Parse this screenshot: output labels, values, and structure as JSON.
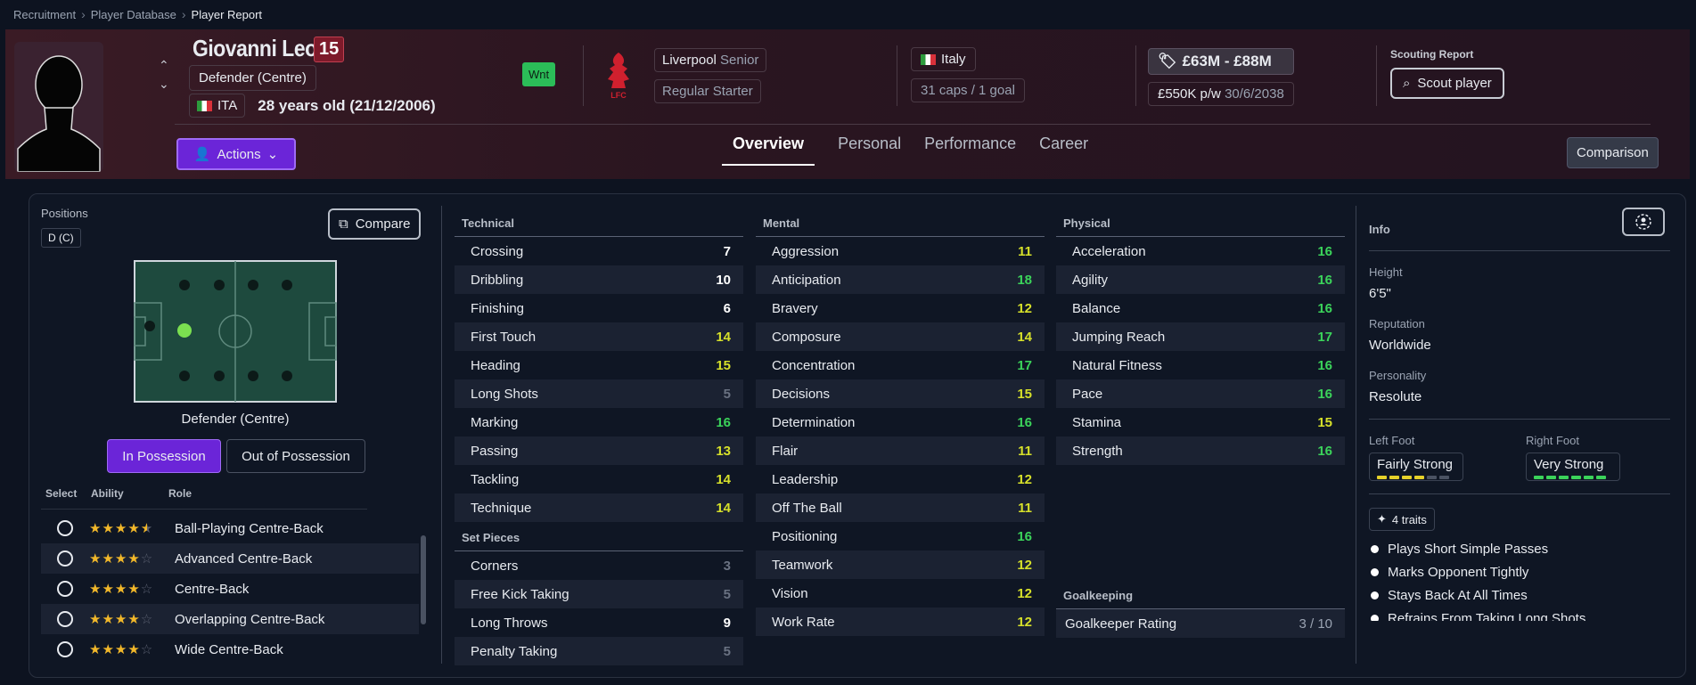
{
  "breadcrumb": {
    "items": [
      "Recruitment",
      "Player Database"
    ],
    "current": "Player Report"
  },
  "player": {
    "name": "Giovanni Leoni",
    "number": "15",
    "position": "Defender (Centre)",
    "nation_code": "ITA",
    "age": "28 years old (21/12/2006)",
    "badge": "Wnt",
    "club": "Liverpool",
    "squad": "Senior",
    "squad_status": "Regular Starter",
    "nation": "Italy",
    "caps": "31 caps / 1 goal",
    "value": "£63M - £88M",
    "wage": "£550K p/w",
    "contract": "30/6/2038"
  },
  "scouting": {
    "label": "Scouting Report",
    "button": "Scout player"
  },
  "nav": {
    "actions": "Actions",
    "tabs": [
      "Overview",
      "Personal",
      "Performance",
      "Career"
    ],
    "comparison": "Comparison"
  },
  "positions": {
    "label": "Positions",
    "tag": "D (C)",
    "compare": "Compare",
    "pitch_label": "Defender (Centre)",
    "in_possession": "In Possession",
    "out_of_possession": "Out of Possession",
    "headers": [
      "Select",
      "Ability",
      "Role"
    ],
    "roles": [
      {
        "name": "Ball-Playing Centre-Back",
        "stars": 4.5
      },
      {
        "name": "Advanced Centre-Back",
        "stars": 4
      },
      {
        "name": "Centre-Back",
        "stars": 4
      },
      {
        "name": "Overlapping Centre-Back",
        "stars": 4
      },
      {
        "name": "Wide Centre-Back",
        "stars": 4
      }
    ]
  },
  "technical": {
    "title": "Technical",
    "items": [
      [
        "Crossing",
        "7"
      ],
      [
        "Dribbling",
        "10"
      ],
      [
        "Finishing",
        "6"
      ],
      [
        "First Touch",
        "14"
      ],
      [
        "Heading",
        "15"
      ],
      [
        "Long Shots",
        "5"
      ],
      [
        "Marking",
        "16"
      ],
      [
        "Passing",
        "13"
      ],
      [
        "Tackling",
        "14"
      ],
      [
        "Technique",
        "14"
      ]
    ]
  },
  "set_pieces": {
    "title": "Set Pieces",
    "items": [
      [
        "Corners",
        "3"
      ],
      [
        "Free Kick Taking",
        "5"
      ],
      [
        "Long Throws",
        "9"
      ],
      [
        "Penalty Taking",
        "5"
      ]
    ]
  },
  "mental": {
    "title": "Mental",
    "items": [
      [
        "Aggression",
        "11"
      ],
      [
        "Anticipation",
        "18"
      ],
      [
        "Bravery",
        "12"
      ],
      [
        "Composure",
        "14"
      ],
      [
        "Concentration",
        "17"
      ],
      [
        "Decisions",
        "15"
      ],
      [
        "Determination",
        "16"
      ],
      [
        "Flair",
        "11"
      ],
      [
        "Leadership",
        "12"
      ],
      [
        "Off The Ball",
        "11"
      ],
      [
        "Positioning",
        "16"
      ],
      [
        "Teamwork",
        "12"
      ],
      [
        "Vision",
        "12"
      ],
      [
        "Work Rate",
        "12"
      ]
    ]
  },
  "physical": {
    "title": "Physical",
    "items": [
      [
        "Acceleration",
        "16"
      ],
      [
        "Agility",
        "16"
      ],
      [
        "Balance",
        "16"
      ],
      [
        "Jumping Reach",
        "17"
      ],
      [
        "Natural Fitness",
        "16"
      ],
      [
        "Pace",
        "16"
      ],
      [
        "Stamina",
        "15"
      ],
      [
        "Strength",
        "16"
      ]
    ]
  },
  "goalkeeping": {
    "title": "Goalkeeping",
    "label": "Goalkeeper Rating",
    "value": "3 / 10"
  },
  "colors": {
    "white": "#ffffff",
    "yellow": "#d6e02a",
    "green": "#3bd35a",
    "grey": "#6a7282"
  },
  "info": {
    "title": "Info",
    "height_label": "Height",
    "height": "6'5\"",
    "reputation_label": "Reputation",
    "reputation": "Worldwide",
    "personality_label": "Personality",
    "personality": "Resolute",
    "left_foot_label": "Left Foot",
    "left_foot": "Fairly Strong",
    "left_foot_level": 4,
    "right_foot_label": "Right Foot",
    "right_foot": "Very Strong",
    "right_foot_level": 6,
    "traits_count": "4 traits",
    "traits": [
      "Plays Short Simple Passes",
      "Marks Opponent Tightly",
      "Stays Back At All Times",
      "Refrains From Taking Long Shots"
    ]
  }
}
